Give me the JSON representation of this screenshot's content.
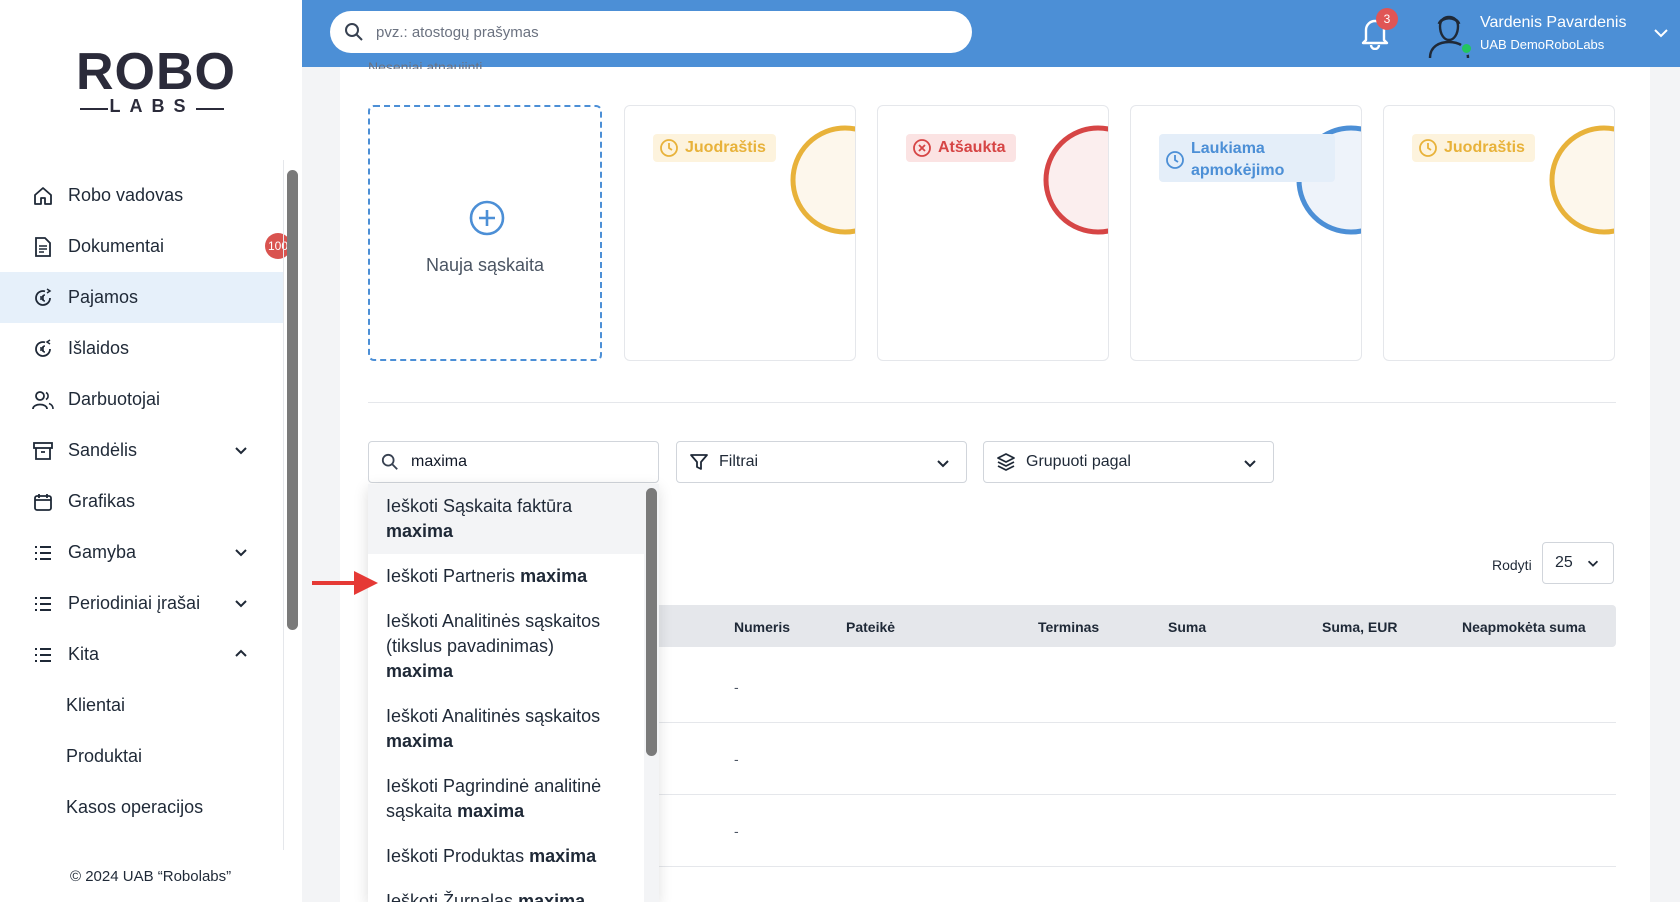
{
  "brand": {
    "word": "ROBO",
    "sub": "LABS"
  },
  "sidebar": {
    "items": [
      {
        "label": "Robo vadovas",
        "icon": "home-icon"
      },
      {
        "label": "Dokumentai",
        "icon": "document-icon",
        "badge": "100"
      },
      {
        "label": "Pajamos",
        "icon": "income-icon",
        "active": true
      },
      {
        "label": "Išlaidos",
        "icon": "expense-icon"
      },
      {
        "label": "Darbuotojai",
        "icon": "users-icon"
      },
      {
        "label": "Sandėlis",
        "icon": "warehouse-icon",
        "chevron": "down"
      },
      {
        "label": "Grafikas",
        "icon": "calendar-icon"
      },
      {
        "label": "Gamyba",
        "icon": "list-icon",
        "chevron": "down"
      },
      {
        "label": "Periodiniai įrašai",
        "icon": "list-icon",
        "chevron": "down"
      },
      {
        "label": "Kita",
        "icon": "list-icon",
        "chevron": "up"
      }
    ],
    "subitems": [
      "Klientai",
      "Produktai",
      "Kasos operacijos"
    ],
    "copyright": "© 2024 UAB “Robolabs”"
  },
  "topbar": {
    "search_placeholder": "pvz.: atostogų prašymas",
    "notifications": "3",
    "user_name": "Vardenis Pavardenis",
    "company": "UAB DemoRoboLabs"
  },
  "main": {
    "recent_label": "Neseniai atnaujinti",
    "new_invoice_label": "Nauja sąskaita",
    "cards": [
      {
        "status": "Juodraštis",
        "color": "#e8b23a"
      },
      {
        "status": "Atšaukta",
        "color": "#d64545"
      },
      {
        "status_line1": "Laukiama",
        "status_line2": "apmokėjimo",
        "color": "#4c8fd6"
      },
      {
        "status": "Juodraštis",
        "color": "#e8b23a"
      }
    ],
    "list_search_value": "maxima",
    "filters_label": "Filtrai",
    "group_label": "Grupuoti pagal",
    "show_label": "Rodyti",
    "show_value": "25",
    "columns": [
      "Numeris",
      "Pateikė",
      "Terminas",
      "Suma",
      "Suma, EUR",
      "Neapmokėta suma"
    ],
    "rows": [
      "-",
      "-",
      "-"
    ]
  },
  "suggestions": [
    {
      "prefix": "Ieškoti Sąskaita faktūra",
      "term": "maxima"
    },
    {
      "prefix": "Ieškoti Partneris",
      "term": "maxima"
    },
    {
      "prefix": "Ieškoti Analitinės sąskaitos (tikslus pavadinimas)",
      "term": "maxima"
    },
    {
      "prefix": "Ieškoti Analitinės sąskaitos",
      "term": "maxima"
    },
    {
      "prefix": "Ieškoti Pagrindinė analitinė sąskaita",
      "term": "maxima"
    },
    {
      "prefix": "Ieškoti Produktas",
      "term": "maxima"
    },
    {
      "prefix": "Ieškoti Žurnalas",
      "term": "maxima"
    }
  ],
  "colors": {
    "accent": "#4c8fd6",
    "badge": "#d9534f",
    "arrow": "#e53935"
  }
}
